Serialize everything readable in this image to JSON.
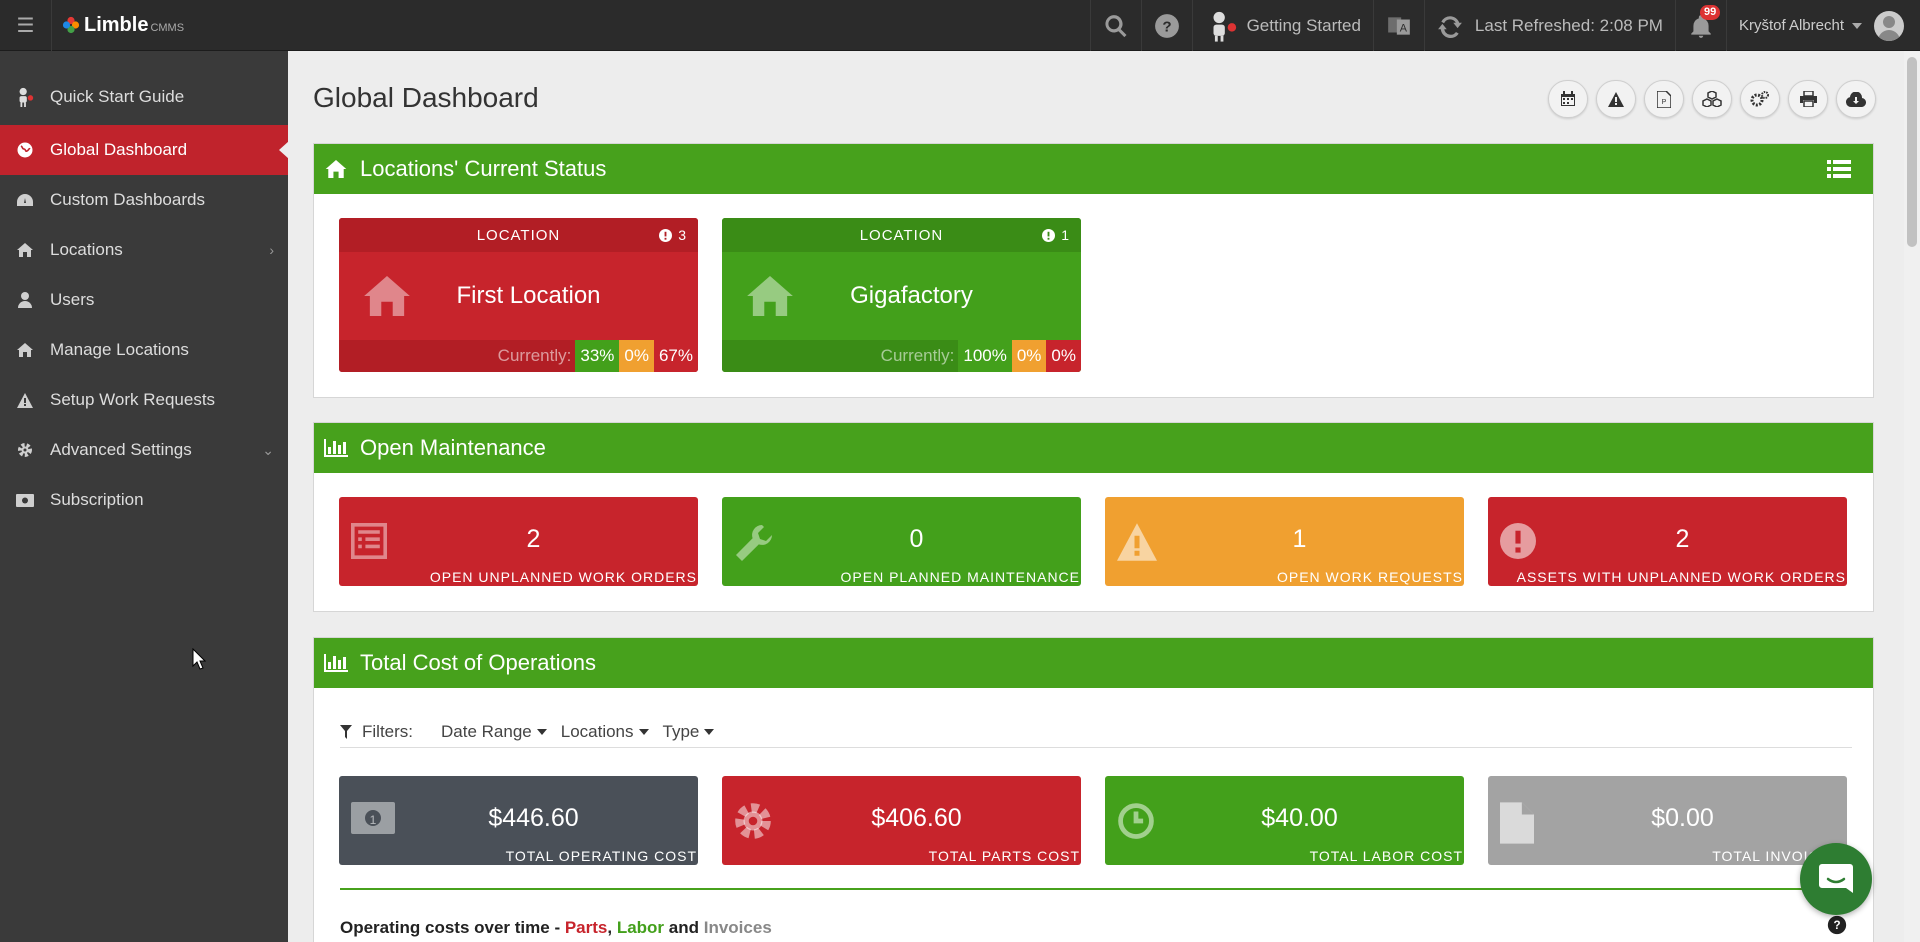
{
  "app": {
    "logo_text": "Limble",
    "logo_sub": "CMMS"
  },
  "topbar": {
    "getting_started": "Getting Started",
    "last_refreshed": "Last Refreshed: 2:08 PM",
    "notifications_count": "99",
    "user_name": "Kryštof Albrecht"
  },
  "sidebar": {
    "items": [
      {
        "label": "Quick Start Guide",
        "icon": "robot-icon"
      },
      {
        "label": "Global Dashboard",
        "icon": "globe-icon",
        "active": true
      },
      {
        "label": "Custom Dashboards",
        "icon": "dashboard-icon"
      },
      {
        "label": "Locations",
        "icon": "home-icon"
      },
      {
        "label": "Users",
        "icon": "user-icon"
      },
      {
        "label": "Manage Locations",
        "icon": "home-icon"
      },
      {
        "label": "Setup Work Requests",
        "icon": "warning-icon"
      },
      {
        "label": "Advanced Settings",
        "icon": "gear-icon"
      },
      {
        "label": "Subscription",
        "icon": "money-icon"
      }
    ]
  },
  "main": {
    "title": "Global Dashboard"
  },
  "locations_panel": {
    "title": "Locations' Current Status",
    "cards": [
      {
        "header": "LOCATION",
        "count": "3",
        "name": "First Location",
        "currently": "Currently:",
        "pct_green": "33%",
        "pct_orange": "0%",
        "pct_red": "67%"
      },
      {
        "header": "LOCATION",
        "count": "1",
        "name": "Gigafactory",
        "currently": "Currently:",
        "pct_green": "100%",
        "pct_orange": "0%",
        "pct_red": "0%"
      }
    ]
  },
  "open_maintenance": {
    "title": "Open Maintenance",
    "stats": [
      {
        "value": "2",
        "label": "OPEN UNPLANNED WORK ORDERS"
      },
      {
        "value": "0",
        "label": "OPEN PLANNED MAINTENANCE"
      },
      {
        "value": "1",
        "label": "OPEN WORK REQUESTS"
      },
      {
        "value": "2",
        "label": "ASSETS WITH UNPLANNED WORK ORDERS"
      }
    ]
  },
  "total_cost": {
    "title": "Total Cost of Operations",
    "filters_label": "Filters:",
    "filters": [
      "Date Range",
      "Locations",
      "Type"
    ],
    "stats": [
      {
        "value": "$446.60",
        "label": "TOTAL OPERATING COST"
      },
      {
        "value": "$406.60",
        "label": "TOTAL PARTS COST"
      },
      {
        "value": "$40.00",
        "label": "TOTAL LABOR COST"
      },
      {
        "value": "$0.00",
        "label": "TOTAL INVOICE C"
      }
    ],
    "chart_title_prefix": "Operating costs over time - ",
    "chart_title_parts": "Parts",
    "chart_title_sep1": ", ",
    "chart_title_labor": "Labor",
    "chart_title_sep2": " and ",
    "chart_title_invoices": "Invoices"
  },
  "colors": {
    "green": "#47a11c",
    "red": "#c7242c",
    "orange": "#f0a030",
    "sidebar": "#3a3a3a",
    "topbar": "#2b2b2b"
  }
}
